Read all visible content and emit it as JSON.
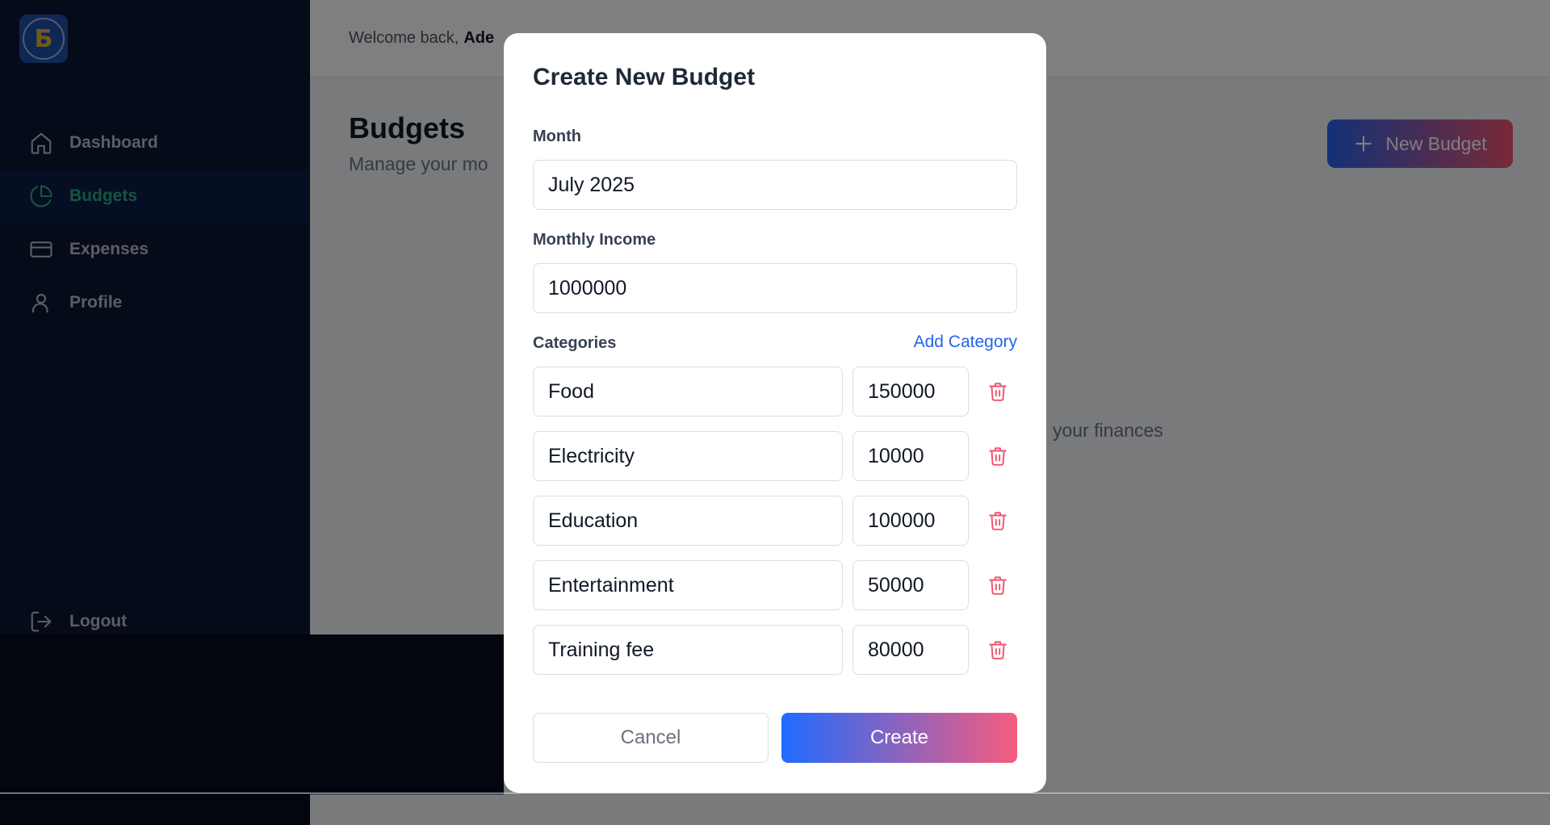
{
  "sidebar": {
    "logo_letter": "Б",
    "items": [
      {
        "label": "Dashboard",
        "icon": "home-icon",
        "active": false
      },
      {
        "label": "Budgets",
        "icon": "pie-chart-icon",
        "active": true
      },
      {
        "label": "Expenses",
        "icon": "credit-card-icon",
        "active": false
      },
      {
        "label": "Profile",
        "icon": "user-icon",
        "active": false
      }
    ],
    "logout_label": "Logout"
  },
  "header": {
    "welcome_prefix": "Welcome back,",
    "user_name": "Ade"
  },
  "page": {
    "title": "Budgets",
    "subtitle": "Manage your mo",
    "new_budget_label": "New Budget",
    "empty_text": "your finances"
  },
  "modal": {
    "title": "Create New Budget",
    "month_label": "Month",
    "month_value": "July 2025",
    "income_label": "Monthly Income",
    "income_value": "1000000",
    "categories_label": "Categories",
    "add_category_label": "Add Category",
    "categories": [
      {
        "name": "Food",
        "amount": "150000"
      },
      {
        "name": "Electricity",
        "amount": "10000"
      },
      {
        "name": "Education",
        "amount": "100000"
      },
      {
        "name": "Entertainment",
        "amount": "50000"
      },
      {
        "name": "Training fee",
        "amount": "80000"
      }
    ],
    "cancel_label": "Cancel",
    "create_label": "Create"
  },
  "colors": {
    "sidebar_bg": "#0c1633",
    "active_accent": "#2fa985",
    "delete_icon": "#f1546e",
    "link": "#2563eb"
  }
}
